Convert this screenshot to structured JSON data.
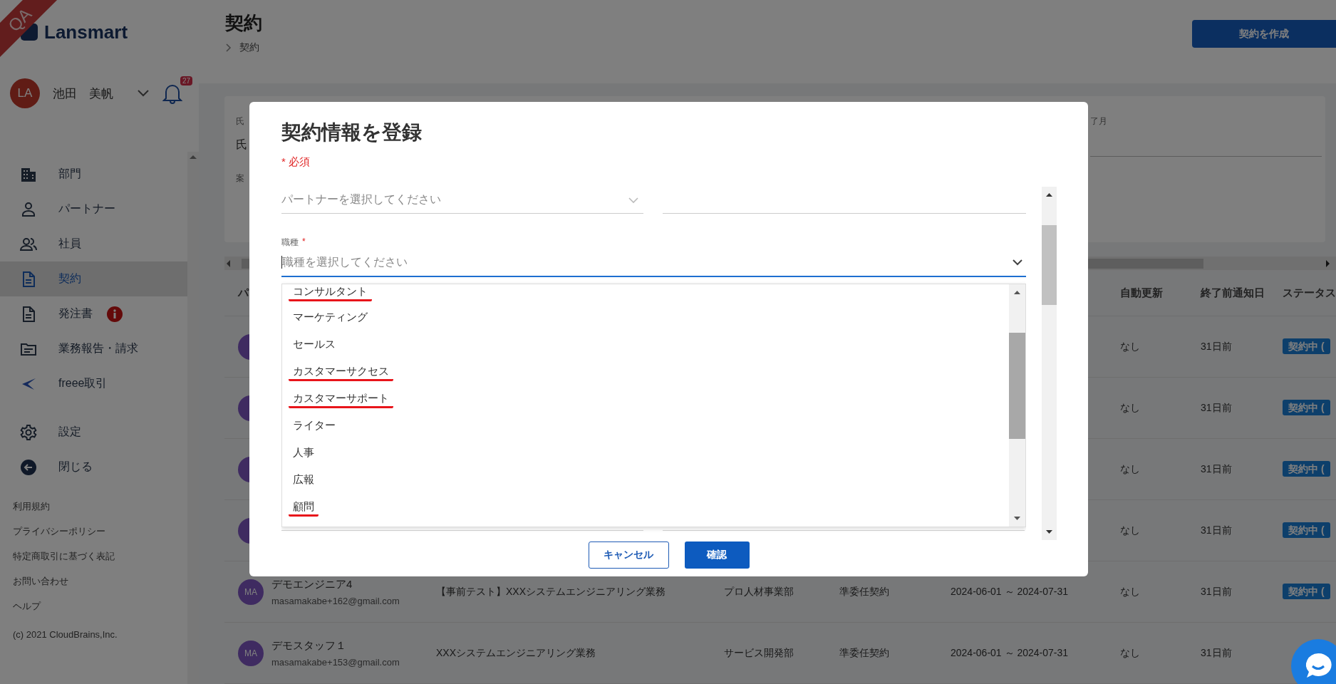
{
  "ribbon": "QA",
  "logo": "Lansmart",
  "user": {
    "initials": "LA",
    "name": "池田　美帆",
    "notifications": "27"
  },
  "nav": [
    {
      "label": "部門",
      "selected": false,
      "alert": false
    },
    {
      "label": "パートナー",
      "selected": false,
      "alert": false
    },
    {
      "label": "社員",
      "selected": false,
      "alert": false
    },
    {
      "label": "契約",
      "selected": true,
      "alert": false
    },
    {
      "label": "発注書",
      "selected": false,
      "alert": true
    },
    {
      "label": "業務報告・請求",
      "selected": false,
      "alert": false
    },
    {
      "label": "freee取引",
      "selected": false,
      "alert": false
    }
  ],
  "bottom_nav": [
    "設定",
    "閉じる"
  ],
  "footer_links": [
    "利用規約",
    "プライバシーポリシー",
    "特定商取引に基づく表記",
    "お問い合わせ",
    "ヘルプ"
  ],
  "copyright": "(c) 2021 CloudBrains,Inc.",
  "page": {
    "title": "契約",
    "breadcrumb": "契約",
    "create_button": "契約を作成"
  },
  "filters": {
    "label_1": "氏",
    "value_1": "氏",
    "label_2": "案",
    "right_label": "了月"
  },
  "table": {
    "columns": [
      "パ",
      "自動更新",
      "終了前通知日",
      "ステータス"
    ],
    "rows": [
      {
        "auto_renew": "なし",
        "notice": "31日前",
        "status": "契約中 ("
      },
      {
        "auto_renew": "なし",
        "notice": "31日前",
        "status": "契約中 ("
      },
      {
        "auto_renew": "なし",
        "notice": "31日前",
        "status": "契約中 ("
      },
      {
        "auto_renew": "なし",
        "notice": "31日前",
        "status": "契約中 ("
      },
      {
        "avatar": "MA",
        "name": "デモエンジニア4",
        "email": "masamakabe+162@gmail.com",
        "project": "【事前テスト】XXXシステムエンジニアリング業務",
        "department": "プロ人材事業部",
        "contract_type": "準委任契約",
        "period": "2024-06-01 ～ 2024-07-31",
        "auto_renew": "なし",
        "notice": "31日前",
        "status": "契約中 ("
      },
      {
        "avatar": "MA",
        "name": "デモスタッフ１",
        "email": "masamakabe+153@gmail.com",
        "project": "XXXシステムエンジニアリング業務",
        "department": "サービス開発部",
        "contract_type": "準委任契約",
        "period": "2024-06-01 ～ 2024-07-31",
        "auto_renew": "なし",
        "notice": "31日前"
      }
    ]
  },
  "modal": {
    "title": "契約情報を登録",
    "required_note": "* 必須",
    "partner": {
      "placeholder": "パートナーを選択してください"
    },
    "job": {
      "label": "職種",
      "required_mark": "*",
      "placeholder": "職種を選択してください",
      "options": [
        {
          "label": "コンサルタント",
          "underlined": true
        },
        {
          "label": "マーケティング",
          "underlined": false
        },
        {
          "label": "セールス",
          "underlined": false
        },
        {
          "label": "カスタマーサクセス",
          "underlined": true
        },
        {
          "label": "カスタマーサポート",
          "underlined": true
        },
        {
          "label": "ライター",
          "underlined": false
        },
        {
          "label": "人事",
          "underlined": false
        },
        {
          "label": "広報",
          "underlined": false
        },
        {
          "label": "顧問",
          "underlined": true
        }
      ]
    },
    "cancel_button": "キャンセル",
    "confirm_button": "確認"
  }
}
